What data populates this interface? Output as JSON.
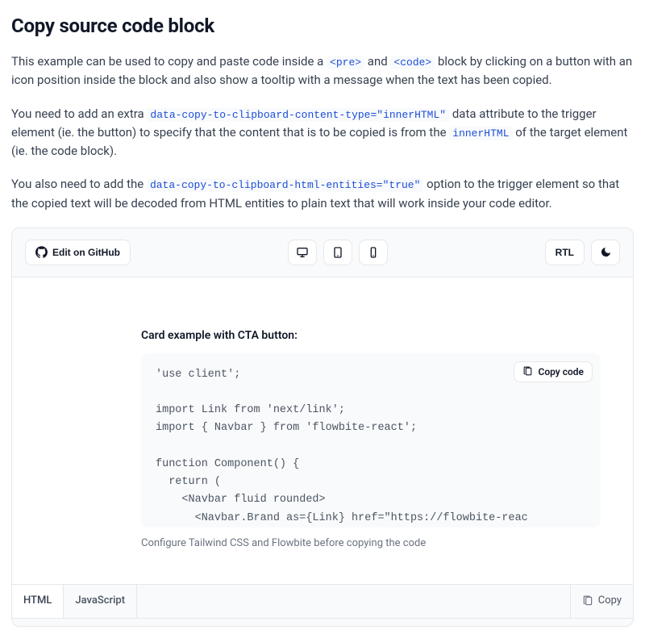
{
  "heading": "Copy source code block",
  "paragraphs": {
    "p1a": "This example can be used to copy and paste code inside a ",
    "p1_code1": "<pre>",
    "p1b": " and ",
    "p1_code2": "<code>",
    "p1c": " block by clicking on a button with an icon position inside the block and also show a tooltip with a message when the text has been copied.",
    "p2a": "You need to add an extra ",
    "p2_code1": "data-copy-to-clipboard-content-type=\"innerHTML\"",
    "p2b": " data attribute to the trigger element (ie. the button) to specify that the content that is to be copied is from the ",
    "p2_code2": "innerHTML",
    "p2c": " of the target element (ie. the code block).",
    "p3a": "You also need to add the ",
    "p3_code1": "data-copy-to-clipboard-html-entities=\"true\"",
    "p3b": " option to the trigger element so that the copied text will be decoded from HTML entities to plain text that will work inside your code editor."
  },
  "toolbar": {
    "edit_on_github": "Edit on GitHub",
    "rtl": "RTL"
  },
  "preview": {
    "title": "Card example with CTA button:",
    "copy_code_label": "Copy code",
    "code": "'use client';\n\nimport Link from 'next/link';\nimport { Navbar } from 'flowbite-react';\n\nfunction Component() {\n  return (\n    <Navbar fluid rounded>\n      <Navbar.Brand as={Link} href=\"https://flowbite-reac",
    "caption": "Configure Tailwind CSS and Flowbite before copying the code"
  },
  "tabs": {
    "html": "HTML",
    "javascript": "JavaScript",
    "copy": "Copy"
  }
}
